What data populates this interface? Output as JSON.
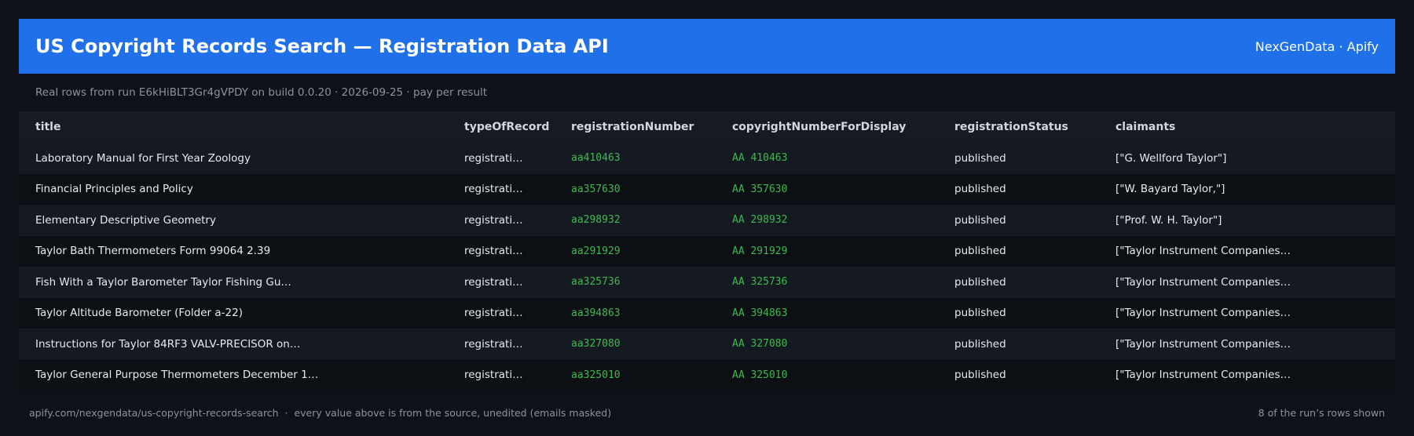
{
  "header": {
    "title": "US Copyright Records Search — Registration Data API",
    "brand": "NexGenData · Apify"
  },
  "subtitle": "Real rows from run E6kHiBLT3Gr4gVPDY on build 0.0.20 · 2026-09-25 · pay per result",
  "table": {
    "columns": [
      "title",
      "typeOfRecord",
      "registrationNumber",
      "copyrightNumberForDisplay",
      "registrationStatus",
      "claimants"
    ],
    "rows": [
      [
        "Laboratory Manual for First Year Zoology",
        "registrati…",
        "aa410463",
        "AA 410463",
        "published",
        "[\"G. Wellford Taylor\"]"
      ],
      [
        "Financial Principles and Policy",
        "registrati…",
        "aa357630",
        "AA 357630",
        "published",
        "[\"W. Bayard Taylor,\"]"
      ],
      [
        "Elementary Descriptive Geometry",
        "registrati…",
        "aa298932",
        "AA 298932",
        "published",
        "[\"Prof. W. H. Taylor\"]"
      ],
      [
        "Taylor Bath Thermometers Form 99064 2.39",
        "registrati…",
        "aa291929",
        "AA 291929",
        "published",
        "[\"Taylor Instrument Companies…"
      ],
      [
        "Fish With a Taylor Barometer Taylor Fishing Gu…",
        "registrati…",
        "aa325736",
        "AA 325736",
        "published",
        "[\"Taylor Instrument Companies…"
      ],
      [
        "Taylor Altitude Barometer (Folder a-22)",
        "registrati…",
        "aa394863",
        "AA 394863",
        "published",
        "[\"Taylor Instrument Companies…"
      ],
      [
        "Instructions for Taylor 84RF3 VALV-PRECISOR on…",
        "registrati…",
        "aa327080",
        "AA 327080",
        "published",
        "[\"Taylor Instrument Companies…"
      ],
      [
        "Taylor General Purpose Thermometers December 1…",
        "registrati…",
        "aa325010",
        "AA 325010",
        "published",
        "[\"Taylor Instrument Companies…"
      ]
    ]
  },
  "footer": {
    "source": "apify.com/nexgendata/us-copyright-records-search  ·  every value above is from the source, unedited (emails masked)",
    "count": "8 of the run’s rows shown"
  },
  "colors": {
    "accent": "#2071e9",
    "background": "#0e1117",
    "code_green": "#3fb950"
  }
}
